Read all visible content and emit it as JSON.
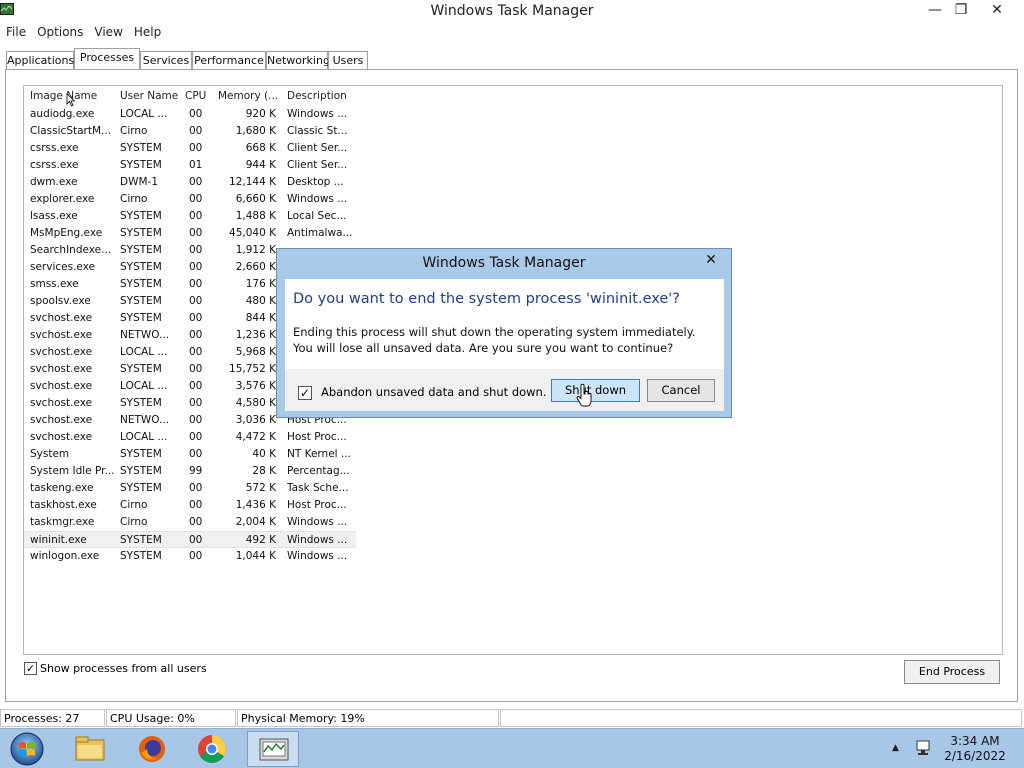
{
  "window": {
    "title": "Windows Task Manager",
    "controls": {
      "minimize": "—",
      "restore": "❐",
      "close": "✕"
    }
  },
  "menu": [
    "File",
    "Options",
    "View",
    "Help"
  ],
  "tabs": [
    {
      "label": "Applications",
      "active": false
    },
    {
      "label": "Processes",
      "active": true
    },
    {
      "label": "Services",
      "active": false
    },
    {
      "label": "Performance",
      "active": false
    },
    {
      "label": "Networking",
      "active": false
    },
    {
      "label": "Users",
      "active": false
    }
  ],
  "process_table": {
    "columns": [
      "Image Name",
      "User Name",
      "CPU",
      "Memory (...",
      "Description"
    ],
    "rows": [
      [
        "audiodg.exe",
        "LOCAL ...",
        "00",
        "920 K",
        "Windows ..."
      ],
      [
        "ClassicStartM...",
        "Cirno",
        "00",
        "1,680 K",
        "Classic St..."
      ],
      [
        "csrss.exe",
        "SYSTEM",
        "00",
        "668 K",
        "Client Ser..."
      ],
      [
        "csrss.exe",
        "SYSTEM",
        "01",
        "944 K",
        "Client Ser..."
      ],
      [
        "dwm.exe",
        "DWM-1",
        "00",
        "12,144 K",
        "Desktop ..."
      ],
      [
        "explorer.exe",
        "Cirno",
        "00",
        "6,660 K",
        "Windows ..."
      ],
      [
        "lsass.exe",
        "SYSTEM",
        "00",
        "1,488 K",
        "Local Sec..."
      ],
      [
        "MsMpEng.exe",
        "SYSTEM",
        "00",
        "45,040 K",
        "Antimalwa..."
      ],
      [
        "SearchIndexe...",
        "SYSTEM",
        "00",
        "1,912 K",
        ""
      ],
      [
        "services.exe",
        "SYSTEM",
        "00",
        "2,660 K",
        ""
      ],
      [
        "smss.exe",
        "SYSTEM",
        "00",
        "176 K",
        ""
      ],
      [
        "spoolsv.exe",
        "SYSTEM",
        "00",
        "480 K",
        ""
      ],
      [
        "svchost.exe",
        "SYSTEM",
        "00",
        "844 K",
        ""
      ],
      [
        "svchost.exe",
        "NETWO...",
        "00",
        "1,236 K",
        ""
      ],
      [
        "svchost.exe",
        "LOCAL ...",
        "00",
        "5,968 K",
        ""
      ],
      [
        "svchost.exe",
        "SYSTEM",
        "00",
        "15,752 K",
        ""
      ],
      [
        "svchost.exe",
        "LOCAL ...",
        "00",
        "3,576 K",
        ""
      ],
      [
        "svchost.exe",
        "SYSTEM",
        "00",
        "4,580 K",
        ""
      ],
      [
        "svchost.exe",
        "NETWO...",
        "00",
        "3,036 K",
        "Host Proc..."
      ],
      [
        "svchost.exe",
        "LOCAL ...",
        "00",
        "4,472 K",
        "Host Proc..."
      ],
      [
        "System",
        "SYSTEM",
        "00",
        "40 K",
        "NT Kernel ..."
      ],
      [
        "System Idle Pr...",
        "SYSTEM",
        "99",
        "28 K",
        "Percentag..."
      ],
      [
        "taskeng.exe",
        "SYSTEM",
        "00",
        "572 K",
        "Task Sche..."
      ],
      [
        "taskhost.exe",
        "Cirno",
        "00",
        "1,436 K",
        "Host Proc..."
      ],
      [
        "taskmgr.exe",
        "Cirno",
        "00",
        "2,004 K",
        "Windows ..."
      ],
      [
        "wininit.exe",
        "SYSTEM",
        "00",
        "492 K",
        "Windows ..."
      ],
      [
        "winlogon.exe",
        "SYSTEM",
        "00",
        "1,044 K",
        "Windows ..."
      ]
    ],
    "selected_row": "wininit.exe"
  },
  "show_all_users": {
    "label": "Show processes from all users",
    "checked": true
  },
  "end_process_label": "End Process",
  "status": {
    "processes": "Processes: 27",
    "cpu": "CPU Usage: 0%",
    "memory": "Physical Memory: 19%"
  },
  "dialog": {
    "title": "Windows Task Manager",
    "close_glyph": "✕",
    "heading": "Do you want to end the system process 'wininit.exe'?",
    "message": "Ending this process will shut down the operating system immediately.  You will lose all unsaved data.  Are you sure you want to continue?",
    "checkbox_label": "Abandon unsaved data and shut down.",
    "checkbox_checked": true,
    "primary_button": "Shut down",
    "secondary_button": "Cancel"
  },
  "taskbar": {
    "items": [
      "start-orb",
      "file-explorer",
      "firefox",
      "chrome",
      "task-manager"
    ],
    "active_item": "task-manager",
    "time": "3:34 AM",
    "date": "2/16/2022"
  },
  "colors": {
    "dialog_frame": "#a9c9e9",
    "dialog_heading": "#1e3f8e",
    "taskbar": "#a8c6e6",
    "primary_button": "#cce4f7"
  }
}
